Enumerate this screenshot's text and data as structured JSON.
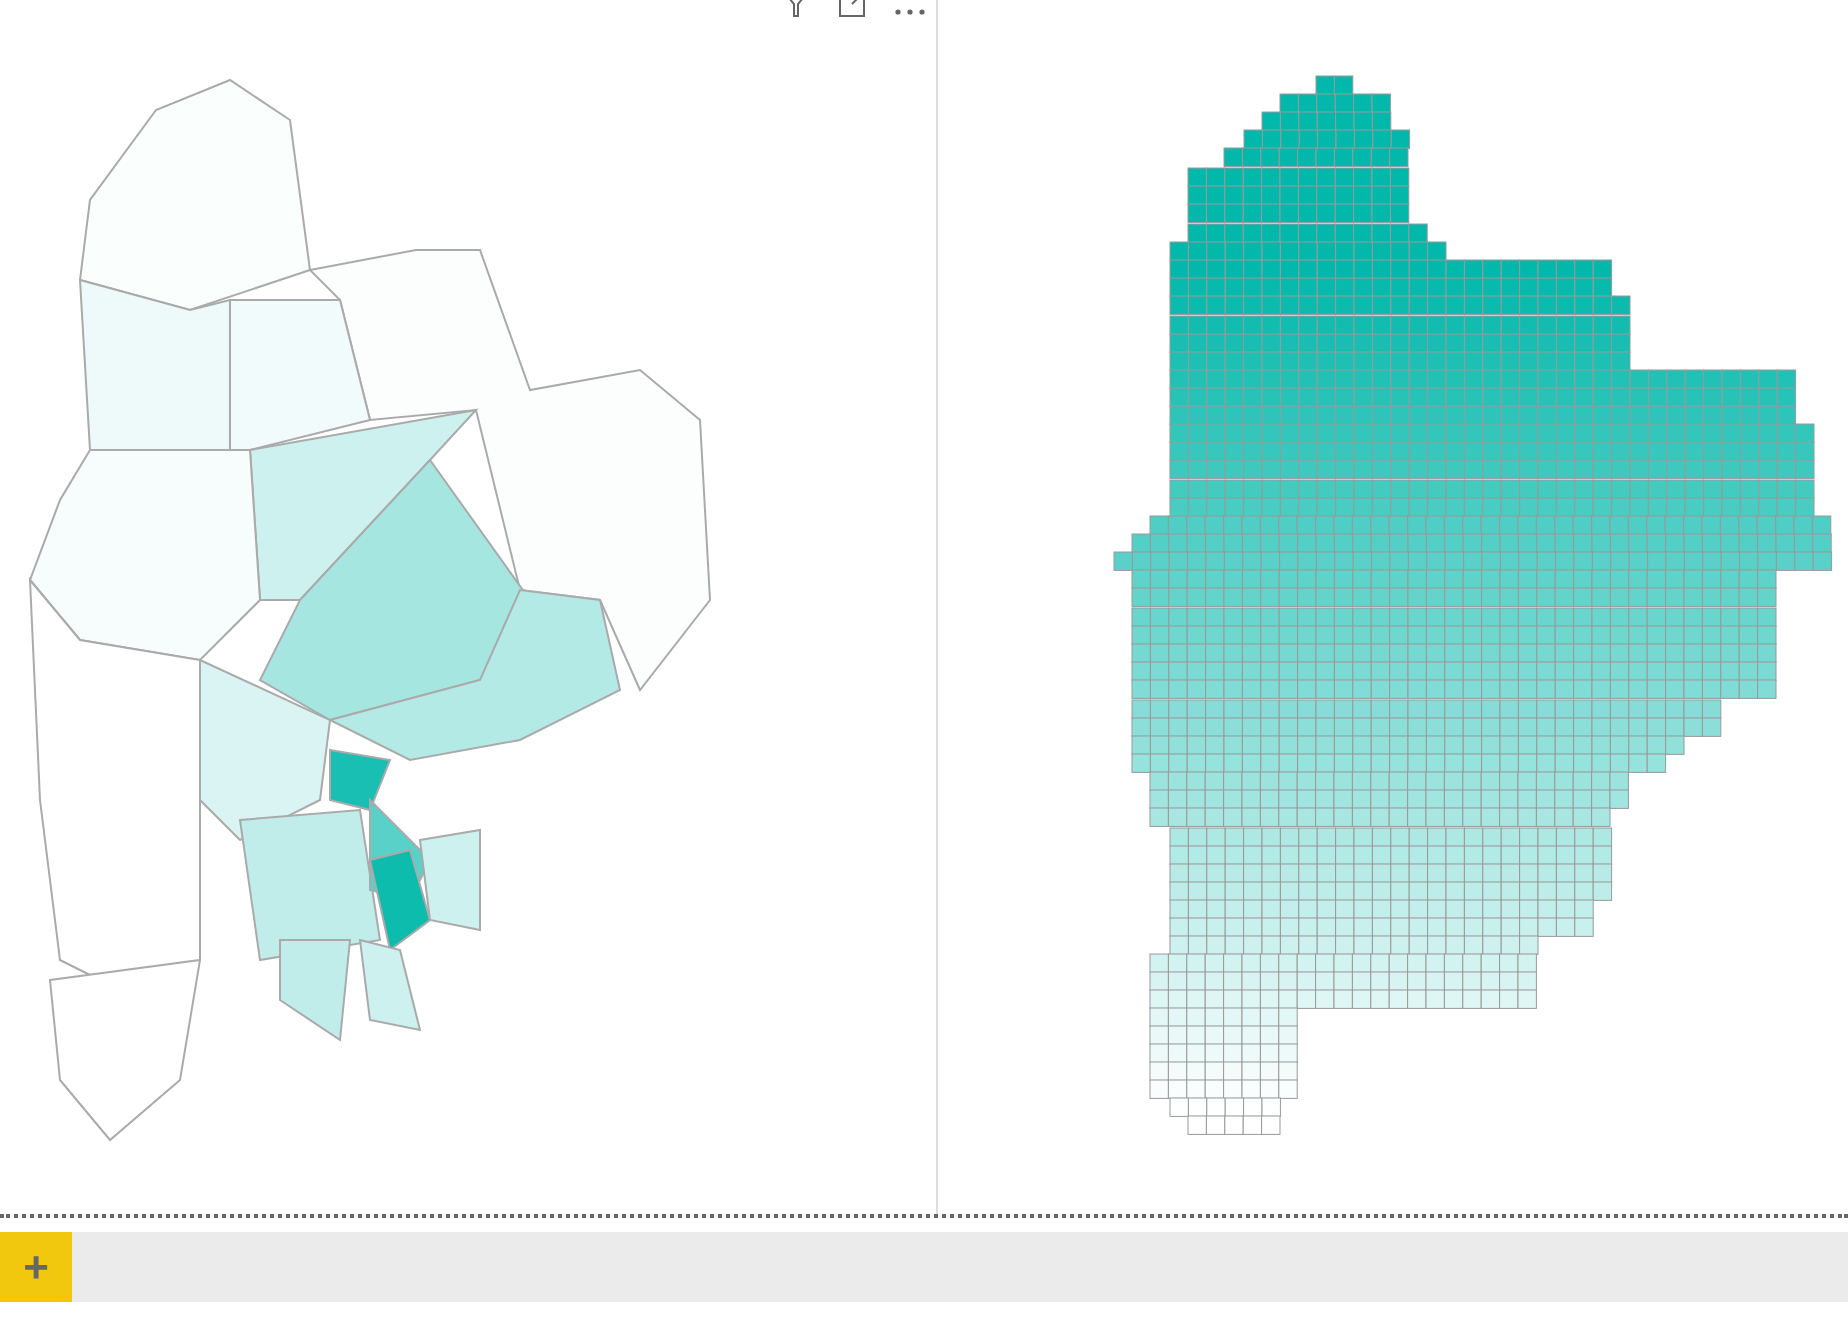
{
  "visuals": [
    {
      "kind": "region_map"
    },
    {
      "kind": "grid_map"
    }
  ],
  "page_tabs": {
    "add_label": "+"
  }
}
